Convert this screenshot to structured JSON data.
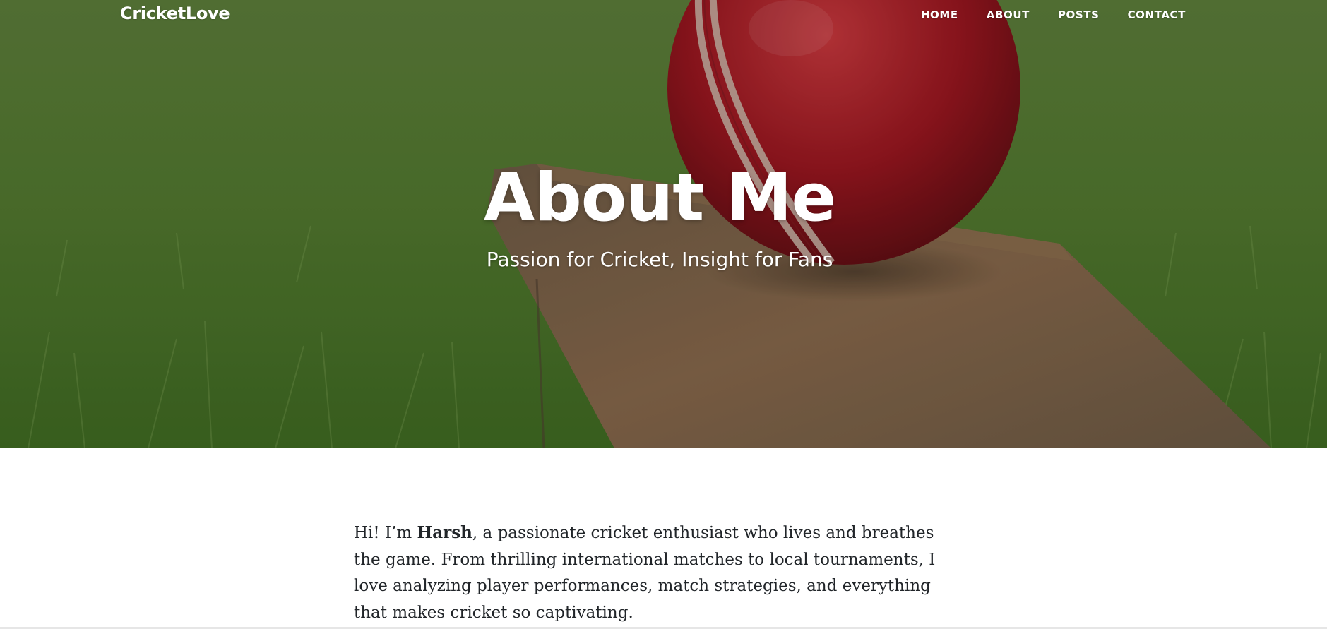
{
  "nav": {
    "brand": "CricketLove",
    "links": [
      "HOME",
      "ABOUT",
      "POSTS",
      "CONTACT"
    ]
  },
  "hero": {
    "title": "About Me",
    "subtitle": "Passion for Cricket, Insight for Fans"
  },
  "about": {
    "intro_prefix": "Hi! I’m ",
    "name": "Harsh",
    "intro_rest": ", a passionate cricket enthusiast who lives and breathes the game. From thrilling international matches to local tournaments, I love analyzing player performances, match strategies, and everything that makes cricket so captivating."
  }
}
